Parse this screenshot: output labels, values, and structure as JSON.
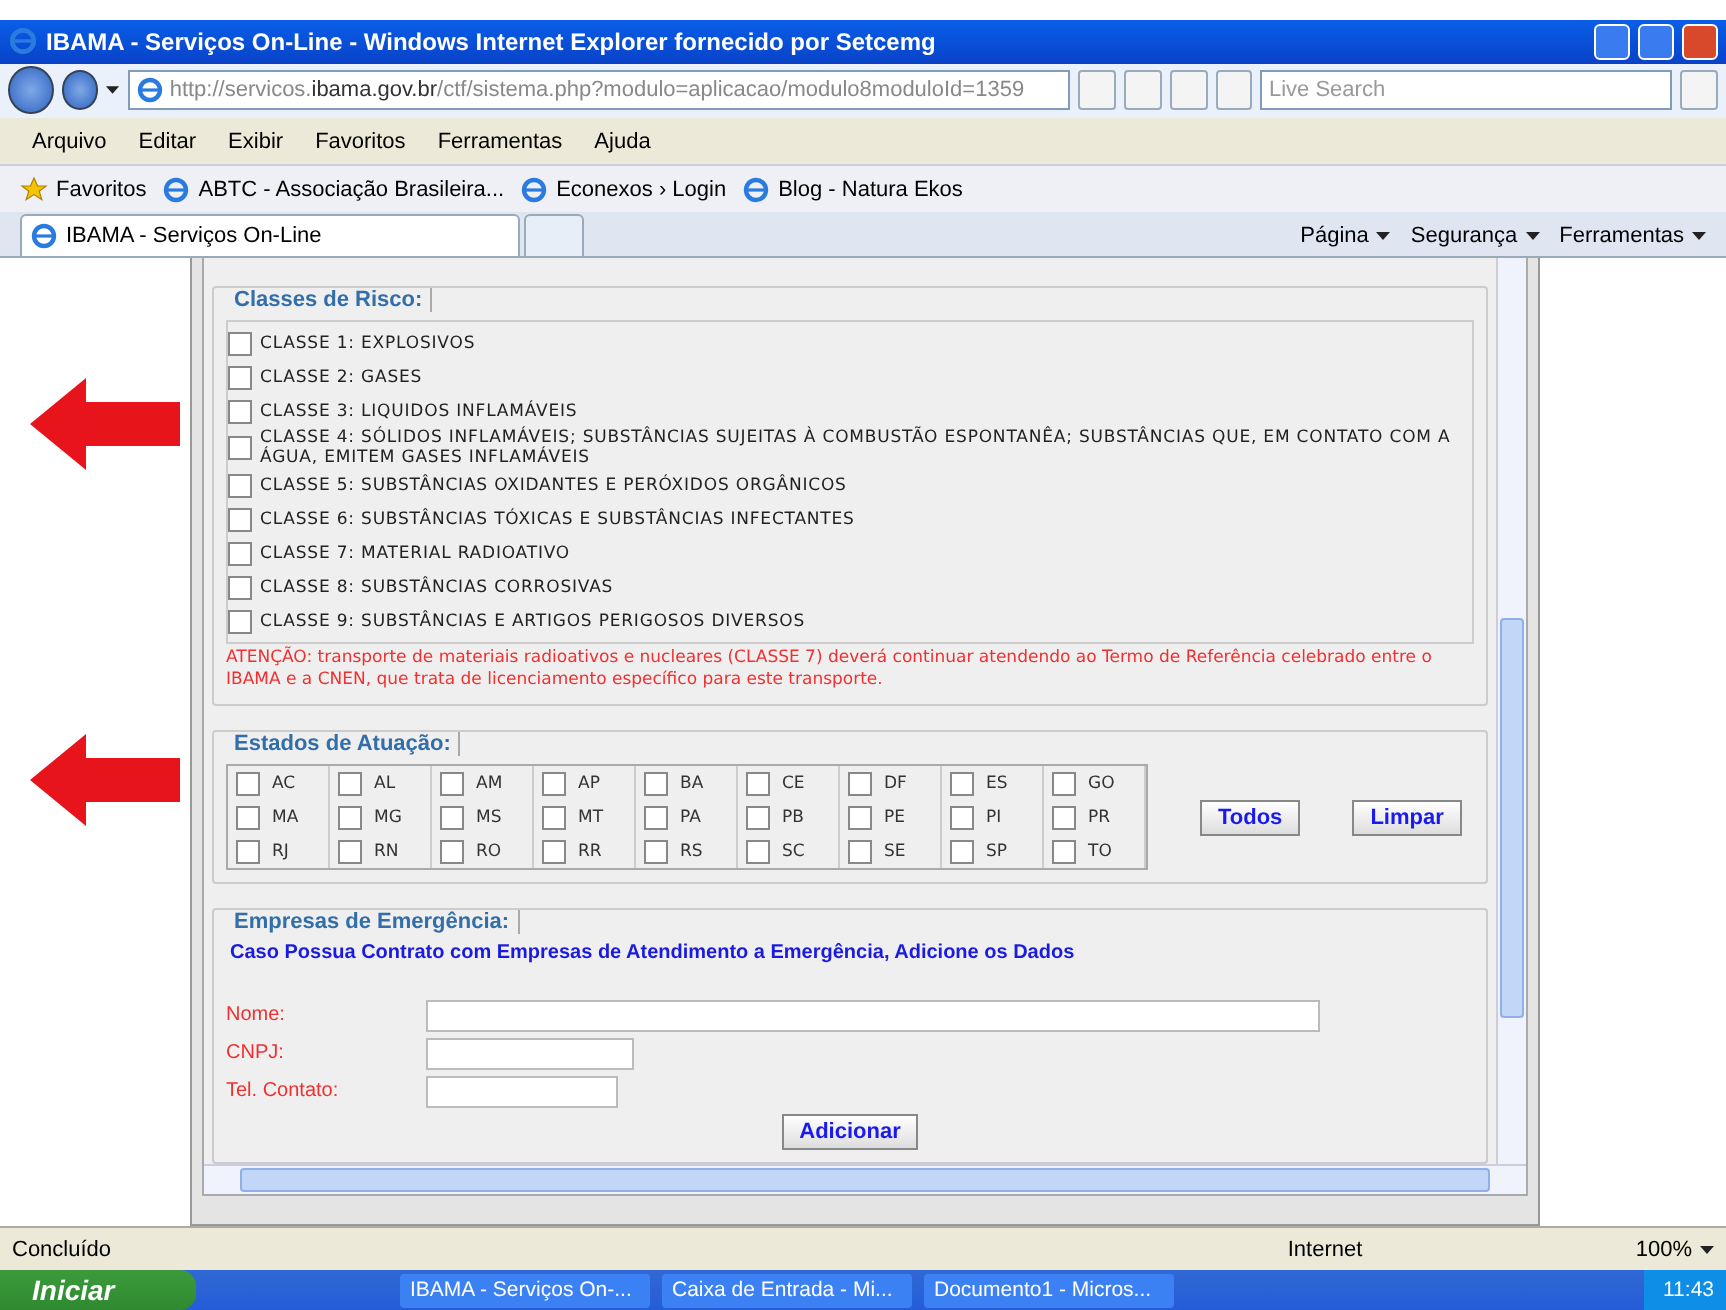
{
  "window": {
    "title": "IBAMA - Serviços On-Line - Windows Internet Explorer fornecido por Setcemg"
  },
  "address_bar": {
    "url": "http://servicos.**ibama.gov.br**/ctf/sistema.php?modulo=aplicacao/modulo8moduloId=1359"
  },
  "search": {
    "placeholder": "Live Search"
  },
  "menu": [
    "Arquivo",
    "Editar",
    "Exibir",
    "Favoritos",
    "Ferramentas",
    "Ajuda"
  ],
  "favorites_bar": {
    "label": "Favoritos",
    "links": [
      "ABTC - Associação Brasileira...",
      "Econexos › Login",
      "Blog - Natura Ekos"
    ]
  },
  "tabs": [
    {
      "label": "IBAMA - Serviços On-Line",
      "selected": true
    }
  ],
  "command_bar": [
    "Página",
    "Segurança",
    "Ferramentas"
  ],
  "risk_classes": {
    "legend": "Classes de Risco:",
    "items": [
      {
        "label": "CLASSE 1: EXPLOSIVOS",
        "checked": false
      },
      {
        "label": "CLASSE 2: GASES",
        "checked": false
      },
      {
        "label": "CLASSE 3: LIQUIDOS INFLAMÁVEIS",
        "checked": false
      },
      {
        "label": "CLASSE 4: SÓLIDOS INFLAMÁVEIS; SUBSTÂNCIAS SUJEITAS À COMBUSTÃO ESPONTANÊA; SUBSTÂNCIAS QUE, EM CONTATO COM A ÁGUA, EMITEM GASES INFLAMÁVEIS",
        "checked": false
      },
      {
        "label": "CLASSE 5: SUBSTÂNCIAS OXIDANTES E PERÓXIDOS ORGÂNICOS",
        "checked": false
      },
      {
        "label": "CLASSE 6: SUBSTÂNCIAS TÓXICAS E SUBSTÂNCIAS INFECTANTES",
        "checked": false
      },
      {
        "label": "CLASSE 7: MATERIAL RADIOATIVO",
        "checked": false
      },
      {
        "label": "CLASSE 8: SUBSTÂNCIAS CORROSIVAS",
        "checked": false
      },
      {
        "label": "CLASSE 9: SUBSTÂNCIAS E ARTIGOS PERIGOSOS DIVERSOS",
        "checked": false
      }
    ],
    "warning": "ATENÇÃO: transporte de materiais radioativos e nucleares (CLASSE 7) deverá continuar atendendo ao Termo de Referência celebrado entre o IBAMA e a CNEN, que trata de licenciamento específico para este transporte."
  },
  "states": {
    "legend": "Estados de Atuação:",
    "items": [
      {
        "label": "AC",
        "checked": false
      },
      {
        "label": "AL",
        "checked": false
      },
      {
        "label": "AM",
        "checked": false
      },
      {
        "label": "AP",
        "checked": false
      },
      {
        "label": "BA",
        "checked": false
      },
      {
        "label": "CE",
        "checked": false
      },
      {
        "label": "DF",
        "checked": false
      },
      {
        "label": "ES",
        "checked": false
      },
      {
        "label": "GO",
        "checked": false
      },
      {
        "label": "MA",
        "checked": false
      },
      {
        "label": "MG",
        "checked": false
      },
      {
        "label": "MS",
        "checked": false
      },
      {
        "label": "MT",
        "checked": false
      },
      {
        "label": "PA",
        "checked": false
      },
      {
        "label": "PB",
        "checked": false
      },
      {
        "label": "PE",
        "checked": false
      },
      {
        "label": "PI",
        "checked": false
      },
      {
        "label": "PR",
        "checked": false
      },
      {
        "label": "RJ",
        "checked": false
      },
      {
        "label": "RN",
        "checked": false
      },
      {
        "label": "RO",
        "checked": false
      },
      {
        "label": "RR",
        "checked": false
      },
      {
        "label": "RS",
        "checked": false
      },
      {
        "label": "SC",
        "checked": false
      },
      {
        "label": "SE",
        "checked": false
      },
      {
        "label": "SP",
        "checked": false
      },
      {
        "label": "TO",
        "checked": false
      }
    ],
    "buttons": [
      "Todos",
      "Limpar"
    ]
  },
  "emergency": {
    "legend": "Empresas de Emergência:",
    "intro": "Caso Possua Contrato com Empresas de Atendimento a Emergência, Adicione os Dados",
    "fields": [
      {
        "label": "Nome:",
        "kind": "long"
      },
      {
        "label": "CNPJ:",
        "kind": "medium"
      },
      {
        "label": "Tel. Contato:",
        "kind": "short"
      }
    ],
    "button": "Adicionar"
  },
  "status_bar": {
    "text": "Concluído",
    "zone": "Internet",
    "zoom": "100%"
  },
  "taskbar": {
    "start": "Iniciar",
    "tasks": [
      "IBAMA - Serviços On-...",
      "Caixa de Entrada - Mi...",
      "Documento1 - Micros..."
    ],
    "clock": "11:43"
  }
}
